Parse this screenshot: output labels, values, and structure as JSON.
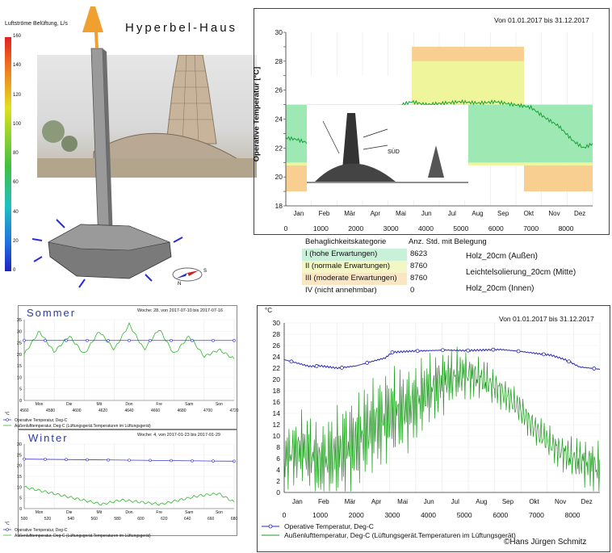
{
  "title": "Hyperbel-Haus",
  "colorbar": {
    "label": "Luftströme Belüftung, L/s",
    "ticks": [
      "160",
      "140",
      "120",
      "100",
      "80",
      "60",
      "40",
      "20",
      "0"
    ]
  },
  "sketch": {
    "label": "SÜD"
  },
  "compass": {
    "s": "S",
    "n": "N"
  },
  "top_chart": {
    "period": "Von 01.01.2017 bis 31.12.2017",
    "ylabel": "Operative Temperatur [°C]",
    "months": [
      "Jan",
      "Feb",
      "Mär",
      "Apr",
      "Mai",
      "Jun",
      "Jul",
      "Aug",
      "Sep",
      "Okt",
      "Nov",
      "Dez"
    ],
    "xticks": [
      "0",
      "1000",
      "2000",
      "3000",
      "4000",
      "5000",
      "6000",
      "7000",
      "8000"
    ],
    "yticks": [
      "18",
      "20",
      "22",
      "24",
      "26",
      "28",
      "30"
    ]
  },
  "comfort_table": {
    "header_category": "Behaglichkeitskategorie",
    "header_hours": "Anz. Std. mit Belegung",
    "rows": [
      {
        "label": "I (hohe Erwartungen)",
        "hours": "8623",
        "color": "#c9f0d8"
      },
      {
        "label": "II (normale Erwartungen)",
        "hours": "8760",
        "color": "#f3f7c6"
      },
      {
        "label": "III (moderate Erwartungen)",
        "hours": "8760",
        "color": "#fbe6c4"
      },
      {
        "label": "IV (nicht annehmbar)",
        "hours": "0",
        "color": "#ffffff"
      }
    ],
    "walls": [
      "Holz_20cm (Außen)",
      "Leichtelsolierung_20cm (Mitte)",
      "Holz_20cm (Innen)"
    ]
  },
  "summer": {
    "title": "Sommer",
    "week": "Woche: 28, von 2017-07-10 bis 2017-07-16",
    "days": [
      "Mon",
      "Die",
      "Mit",
      "Don",
      "Fre",
      "Sam",
      "Son"
    ],
    "xticks": [
      "4560",
      "4580",
      "4600",
      "4620",
      "4640",
      "4660",
      "4680",
      "4700",
      "4720"
    ],
    "yticks": [
      "35",
      "30",
      "25",
      "20",
      "15",
      "10",
      "5",
      "0"
    ]
  },
  "winter": {
    "title": "Winter",
    "week": "Woche: 4, von 2017-01-23 bis 2017-01-29",
    "days": [
      "Mon",
      "Die",
      "Mit",
      "Don",
      "Fre",
      "Sam",
      "Son"
    ],
    "xticks": [
      "500",
      "520",
      "540",
      "560",
      "580",
      "600",
      "620",
      "640",
      "660",
      "680"
    ],
    "yticks": [
      "30",
      "25",
      "20",
      "15",
      "10",
      "5",
      "0"
    ]
  },
  "small_legend": {
    "unit": "°C",
    "series_op": "Operative Temperatur, Deg-C",
    "series_out": "Außenlufttemperatur, Deg-C (Lüftungsgerät.Temperaturen im Lüftungsgerät)"
  },
  "big_chart": {
    "unit": "°C",
    "period": "Von 01.01.2017 bis 31.12.2017",
    "months": [
      "Jan",
      "Feb",
      "Mär",
      "Apr",
      "Mai",
      "Jun",
      "Jul",
      "Aug",
      "Sep",
      "Okt",
      "Nov",
      "Dez"
    ],
    "xticks": [
      "0",
      "1000",
      "2000",
      "3000",
      "4000",
      "5000",
      "6000",
      "7000",
      "8000"
    ],
    "yticks": [
      "30",
      "28",
      "26",
      "24",
      "22",
      "20",
      "18",
      "16",
      "14",
      "12",
      "10",
      "8",
      "6",
      "4",
      "2",
      "0"
    ],
    "legend_op": "Operative Temperatur, Deg-C",
    "legend_out": "Außenlufttemperatur, Deg-C (Lüftungsgerät.Temperaturen im Lüftungsgerät)"
  },
  "copyright": "©Hans Jürgen Schmitz",
  "chart_data": [
    {
      "type": "line",
      "title": "Von 01.01.2017 bis 31.12.2017",
      "ylabel": "Operative Temperatur [°C]",
      "xlim": [
        0,
        8760
      ],
      "ylim": [
        18,
        30
      ],
      "series": [
        {
          "name": "Operative Temperatur",
          "x": [
            0,
            300,
            700,
            1000,
            1500,
            2000,
            2500,
            2800,
            3000,
            3300,
            3600,
            4000,
            4500,
            5000,
            5500,
            6000,
            6500,
            6800,
            7000,
            7400,
            7800,
            8200,
            8500,
            8760
          ],
          "y": [
            22.7,
            22.6,
            22.3,
            22.4,
            22.5,
            22.6,
            23.0,
            23.9,
            24.5,
            25.0,
            25.2,
            25.0,
            25.1,
            25.2,
            25.1,
            25.2,
            25.0,
            24.9,
            24.8,
            24.1,
            23.5,
            22.5,
            22.0,
            22.3
          ]
        }
      ],
      "bands": {
        "I": {
          "color": "#9ee8b4"
        },
        "II": {
          "color": "#eef59a"
        },
        "III": {
          "color": "#f8cf90"
        }
      }
    },
    {
      "type": "line",
      "title": "Von 01.01.2017 bis 31.12.2017",
      "xlim": [
        0,
        8760
      ],
      "ylim": [
        0,
        30
      ],
      "series": [
        {
          "name": "Operative Temperatur, Deg-C",
          "x": [
            0,
            300,
            700,
            1000,
            1500,
            2000,
            2500,
            2800,
            3000,
            3500,
            4000,
            4500,
            5000,
            5500,
            6000,
            6500,
            7000,
            7400,
            7800,
            8200,
            8500,
            8760
          ],
          "y": [
            23.5,
            23.0,
            22.3,
            22.4,
            22.0,
            22.4,
            23.3,
            23.8,
            24.8,
            25.0,
            25.1,
            25.2,
            25.1,
            25.2,
            25.3,
            25.0,
            24.6,
            24.3,
            23.5,
            22.2,
            22.0,
            21.8
          ]
        },
        {
          "name": "Außenlufttemperatur, Deg-C (Lüftungsgerät.Temperaturen im Lüftungsgerät)",
          "x": [
            0,
            500,
            1000,
            1500,
            2000,
            2500,
            3000,
            3500,
            4000,
            4500,
            5000,
            5500,
            6000,
            6500,
            7000,
            7500,
            8000,
            8500,
            8760
          ],
          "y": [
            6,
            8,
            5,
            7,
            9,
            12,
            14,
            15,
            18,
            20,
            21,
            20,
            18,
            15,
            11,
            8,
            6,
            5,
            4
          ]
        }
      ]
    },
    {
      "type": "line",
      "title": "Woche: 28, von 2017-07-10 bis 2017-07-16",
      "xlim": [
        4560,
        4728
      ],
      "ylim": [
        0,
        35
      ],
      "series": [
        {
          "name": "Operative Temperatur, Deg-C",
          "x": [
            4560,
            4728
          ],
          "y": [
            26,
            26
          ]
        },
        {
          "name": "Außenlufttemperatur, Deg-C (Lüftungsgerät.Temperaturen im Lüftungsgerät)",
          "x": [
            4560,
            4572,
            4584,
            4596,
            4608,
            4620,
            4632,
            4644,
            4656,
            4668,
            4680,
            4692,
            4704,
            4716,
            4728
          ],
          "y": [
            20,
            30,
            21,
            28,
            20,
            30,
            22,
            33,
            22,
            31,
            20,
            28,
            19,
            22,
            18
          ]
        }
      ]
    },
    {
      "type": "line",
      "title": "Woche: 4, von 2017-01-23 bis 2017-01-29",
      "xlim": [
        480,
        696
      ],
      "ylim": [
        0,
        30
      ],
      "series": [
        {
          "name": "Operative Temperatur, Deg-C",
          "x": [
            480,
            696
          ],
          "y": [
            23,
            22
          ]
        },
        {
          "name": "Außenlufttemperatur, Deg-C (Lüftungsgerät.Temperaturen im Lüftungsgerät)",
          "x": [
            480,
            500,
            520,
            540,
            560,
            580,
            600,
            620,
            640,
            660,
            680,
            696
          ],
          "y": [
            10,
            8,
            6,
            4,
            2,
            4,
            3,
            2,
            4,
            6,
            7,
            3
          ]
        }
      ]
    }
  ]
}
